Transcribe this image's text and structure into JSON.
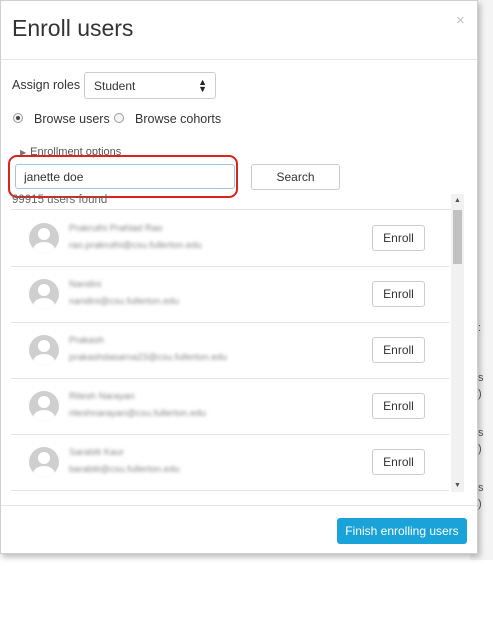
{
  "modal": {
    "title": "Enroll users",
    "close_glyph": "×"
  },
  "assign_roles": {
    "label": "Assign roles",
    "selected": "Student",
    "caret_icon": "select-caret-icon"
  },
  "browse": {
    "users_label": "Browse users",
    "users_checked": true,
    "cohorts_label": "Browse cohorts",
    "cohorts_checked": false
  },
  "enrollment_options": {
    "label": "Enrollment options",
    "expand_icon": "triangle-right-icon"
  },
  "search": {
    "value": "janette doe",
    "button_label": "Search",
    "results_count": "99915 users found"
  },
  "users": [
    {
      "name": "Prakruthi Prahlad Rao",
      "email": "rao.prakruthi@csu.fullerton.edu",
      "enroll_label": "Enroll"
    },
    {
      "name": "Nandini",
      "email": "nandini@csu.fullerton.edu",
      "enroll_label": "Enroll"
    },
    {
      "name": "Prakash",
      "email": "prakashdasarna23@csu.fullerton.edu",
      "enroll_label": "Enroll"
    },
    {
      "name": "Ritesh Narayan",
      "email": "riteshnarayan@csu.fullerton.edu",
      "enroll_label": "Enroll"
    },
    {
      "name": "Sarabiti Kaur",
      "email": "barabiti@csu.fullerton.edu",
      "enroll_label": "Enroll"
    }
  ],
  "footer": {
    "finish_label": "Finish enrolling users"
  },
  "colors": {
    "primary": "#1aa3d9",
    "highlight": "#d9241f"
  }
}
